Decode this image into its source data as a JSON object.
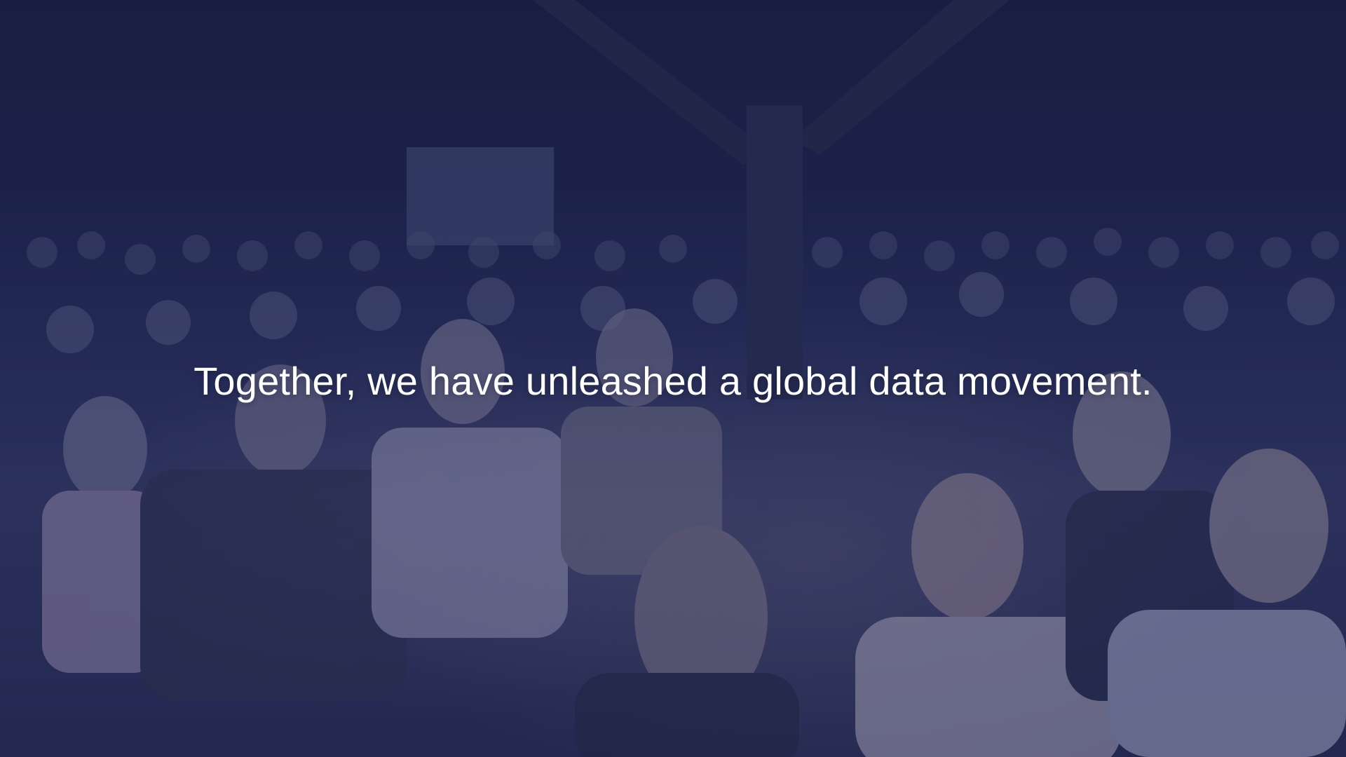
{
  "hero": {
    "headline": "Together, we have unleashed a global data movement.",
    "background": "conference-audience-photo",
    "overlay_color": "#181e4e"
  }
}
